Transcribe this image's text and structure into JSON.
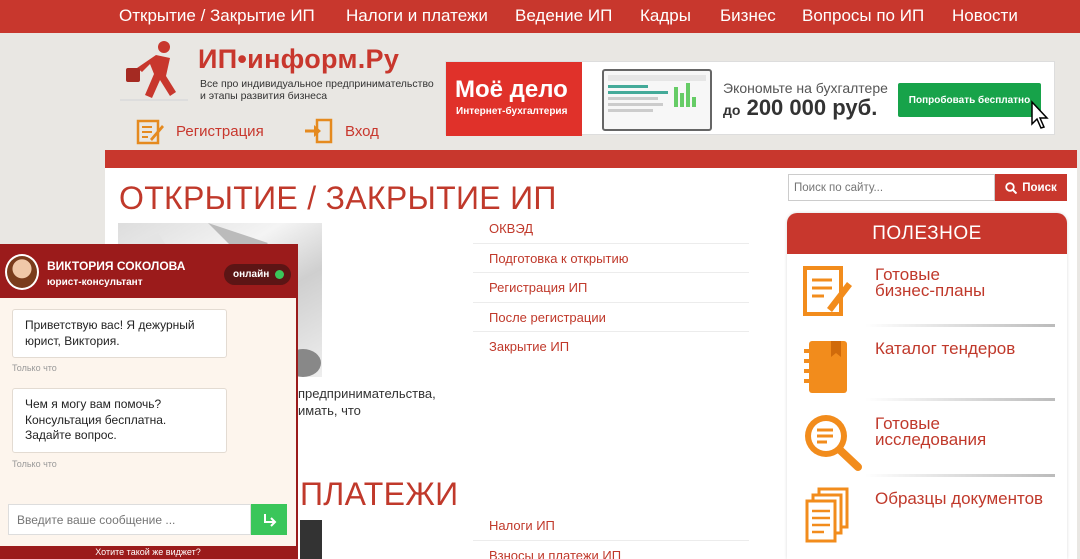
{
  "nav": {
    "items": [
      "Открытие / Закрытие ИП",
      "Налоги и платежи",
      "Ведение ИП",
      "Кадры",
      "Бизнес",
      "Вопросы по ИП",
      "Новости"
    ]
  },
  "header": {
    "logo_title": "ИП•информ.Ру",
    "logo_subtitle": "Все про индивидуальное предпринимательство и этапы развития бизнеса",
    "register_label": "Регистрация",
    "login_label": "Вход"
  },
  "banner": {
    "brand_name": "Моё дело",
    "brand_sub": "Интернет-бухгалтерия",
    "line1": "Экономьте на бухгалтере",
    "line2_prefix": "до",
    "line2_amount": "200 000 руб.",
    "button_label": "Попробовать бесплатно"
  },
  "search": {
    "placeholder": "Поиск по сайту...",
    "button_label": "Поиск"
  },
  "main": {
    "section1_title": "ОТКРЫТИЕ / ЗАКРЫТИЕ ИП",
    "section1_links": [
      "ОКВЭД",
      "Подготовка к открытию",
      "Регистрация ИП",
      "После регистрации",
      "Закрытие ИП"
    ],
    "intro_line1": "предпринимательства,",
    "intro_line2": "имать, что",
    "section2_title": "ПЛАТЕЖИ",
    "section2_links": [
      "Налоги ИП",
      "Взносы и платежи ИП"
    ]
  },
  "useful": {
    "title": "ПОЛЕЗНОЕ",
    "items": [
      {
        "line1": "Готовые",
        "line2": "бизнес-планы",
        "icon": "business-plan-icon"
      },
      {
        "line1": "Каталог тендеров",
        "line2": "",
        "icon": "tender-catalog-icon"
      },
      {
        "line1": "Готовые",
        "line2": "исследования",
        "icon": "research-icon"
      },
      {
        "line1": "Образцы документов",
        "line2": "",
        "icon": "documents-icon"
      }
    ]
  },
  "chat": {
    "name": "ВИКТОРИЯ СОКОЛОВА",
    "role": "юрист-консультант",
    "status": "онлайн",
    "messages": [
      {
        "text": "Приветствую вас! Я дежурный юрист, Виктория.",
        "time": "Только что"
      },
      {
        "text": "Чем я могу вам помочь? Консультация бесплатна. Задайте вопрос.",
        "time": "Только что"
      }
    ],
    "input_placeholder": "Введите ваше сообщение ...",
    "footer": "Хотите такой же виджет?"
  },
  "colors": {
    "brand_red": "#c8372d",
    "chat_red": "#9b1b1b",
    "online_green": "#3ac65a",
    "banner_green": "#17a34a"
  }
}
